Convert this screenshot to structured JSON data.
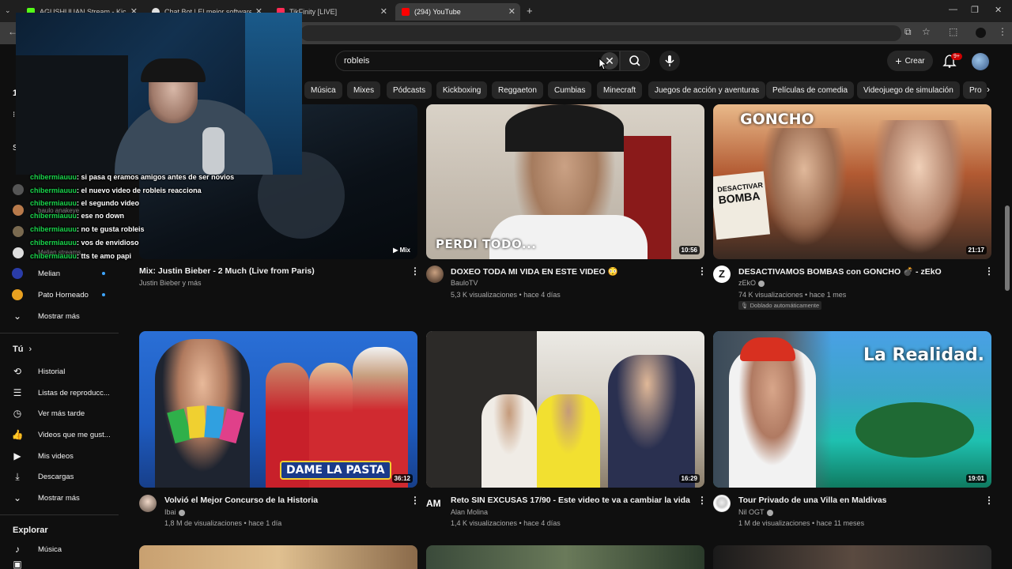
{
  "browser": {
    "tabs": [
      {
        "title": "AGUSHUUAN Stream - Kick Dash",
        "fav": "#53fc18"
      },
      {
        "title": "Chat Bot | El mejor software para",
        "fav": "#e0e0e0"
      },
      {
        "title": "TikFinity [LIVE]",
        "fav": "#fe2c55"
      },
      {
        "title": "(294) YouTube",
        "fav": "#ff0000"
      }
    ],
    "new_tab": "+"
  },
  "search": {
    "value": "robleis"
  },
  "header": {
    "create_label": "Crear",
    "notif_count": "9+"
  },
  "chips": [
    "Música",
    "Mixes",
    "Pódcasts",
    "Kickboxing",
    "Reggaeton",
    "Cumbias",
    "Minecraft",
    "Juegos de acción y aventuras",
    "Películas de comedia",
    "Videojuego de simulación",
    "Pro"
  ],
  "sidebar": {
    "subs": [
      {
        "label": "Melian"
      },
      {
        "label": "Pato Horneado"
      }
    ],
    "show_more": "Mostrar más",
    "you_header": "Tú",
    "you_items": [
      "Historial",
      "Listas de reproducc...",
      "Ver más tarde",
      "Videos que me gust...",
      "Mis videos",
      "Descargas",
      "Mostrar más"
    ],
    "explore_header": "Explorar",
    "explore_items": [
      "Música"
    ]
  },
  "overlay": {
    "chat": [
      {
        "user": "chibermiauuu",
        "msg": ": si pasa q eramos amigos antes de ser novios"
      },
      {
        "user": "chibermiauuu",
        "msg": ": el nuevo video de robleis reacciona"
      },
      {
        "user": "chibermiauuu",
        "msg": ": el segundo video"
      },
      {
        "user": "chibermiauuu",
        "msg": ": ese no down"
      },
      {
        "user": "chibermiauuu",
        "msg": ": no te gusta robleis"
      },
      {
        "user": "chibermiauuu",
        "msg": ": vos de envidioso"
      },
      {
        "user": "chibermiauuu",
        "msg": ": tts te amo papi"
      }
    ],
    "faded": [
      "baulo anakeye",
      "Melian streams"
    ]
  },
  "videos": [
    {
      "title": "Mix: Justin Bieber - 2 Much (Live from Paris)",
      "channel": "Justin Bieber y más",
      "meta": "",
      "duration": "Mix",
      "thumb_text": ""
    },
    {
      "title": "DOXEO TODA MI VIDA EN ESTE VIDEO 😳",
      "channel": "BauloTV",
      "meta": "5,3 K visualizaciones • hace 4 días",
      "duration": "10:56",
      "thumb_text": "PERDI TODO..."
    },
    {
      "title": "DESACTIVAMOS BOMBAS con GONCHO 💣 - zEkO",
      "channel": "zEkO",
      "meta": "74 K visualizaciones • hace 1 mes",
      "duration": "21:17",
      "thumb_text": "GONCHO",
      "badge": "Doblado automáticamente"
    },
    {
      "title": "Volvió el Mejor Concurso de la Historia",
      "channel": "Ibai",
      "meta": "1,8 M de visualizaciones • hace 1 día",
      "duration": "36:12",
      "thumb_text": "DAME LA PASTA"
    },
    {
      "title": "Reto SIN EXCUSAS 17/90 - Este video te va a cambiar la vida",
      "channel": "Alan Molina",
      "meta": "1,4 K visualizaciones • hace 4 días",
      "duration": "16:29",
      "thumb_text": ""
    },
    {
      "title": "Tour Privado de una Villa en Maldivas",
      "channel": "Nil OGT",
      "meta": "1 M de visualizaciones • hace 11 meses",
      "duration": "19:01",
      "thumb_text": "La Realidad."
    }
  ]
}
